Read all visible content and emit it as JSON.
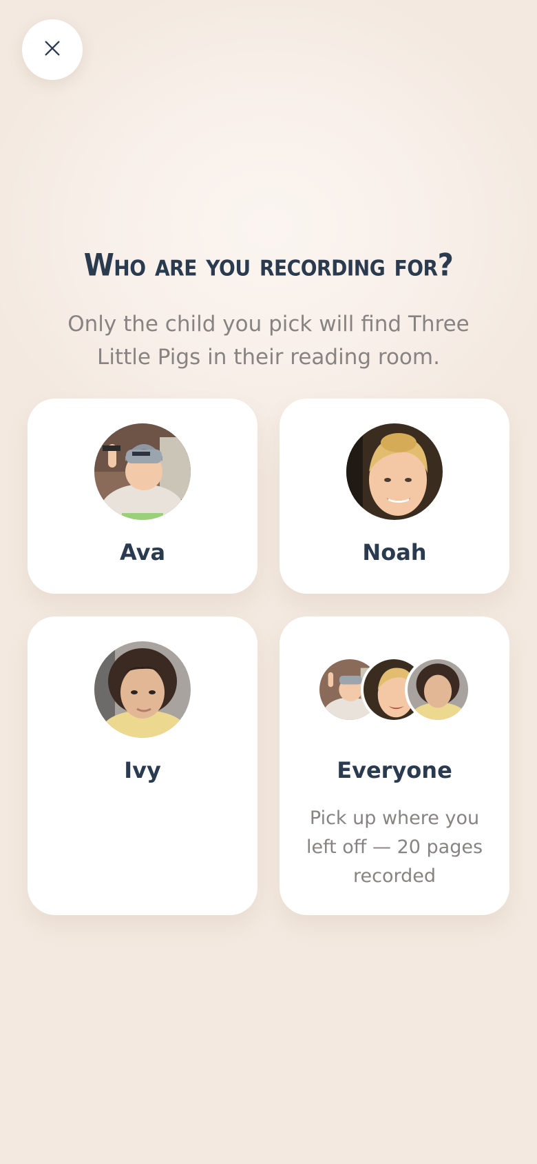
{
  "close": {
    "icon": "close-icon"
  },
  "title": "Who are you recording for?",
  "subtitle": "Only the child you pick will find Three Little Pigs in their reading room.",
  "children": [
    {
      "name": "Ava",
      "avatar": "ava-avatar"
    },
    {
      "name": "Noah",
      "avatar": "noah-avatar"
    },
    {
      "name": "Ivy",
      "avatar": "ivy-avatar"
    }
  ],
  "everyone": {
    "name": "Everyone",
    "description": "Pick up where you left off — 20 pages recorded"
  },
  "colors": {
    "background": "#f3e9e0",
    "title": "#2a3a4f",
    "subtitle": "#878382",
    "card": "#ffffff"
  }
}
